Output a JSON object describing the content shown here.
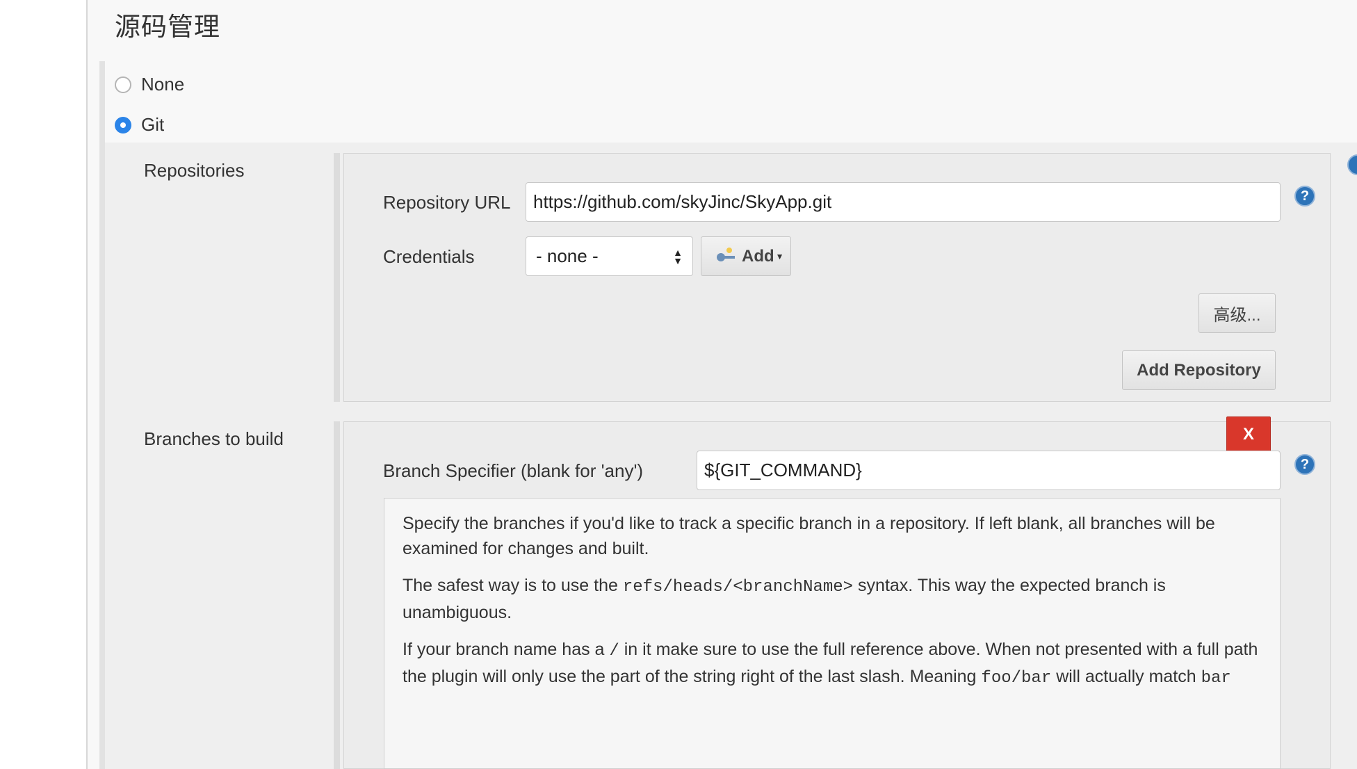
{
  "section": {
    "title": "源码管理"
  },
  "scm": {
    "options": [
      {
        "label": "None",
        "selected": false
      },
      {
        "label": "Git",
        "selected": true
      }
    ]
  },
  "repositories": {
    "label": "Repositories",
    "url_label": "Repository URL",
    "url_value": "https://github.com/skyJinc/SkyApp.git",
    "credentials_label": "Credentials",
    "credentials_value": "- none -",
    "add_label": "Add",
    "advanced_label": "高级...",
    "add_repository_label": "Add Repository"
  },
  "branches": {
    "label": "Branches to build",
    "delete_label": "X",
    "specifier_label": "Branch Specifier (blank for 'any')",
    "specifier_value": "${GIT_COMMAND}",
    "help": {
      "p1": "Specify the branches if you'd like to track a specific branch in a repository. If left blank, all branches will be examined for changes and built.",
      "p2_a": "The safest way is to use the ",
      "p2_code": "refs/heads/<branchName>",
      "p2_b": " syntax. This way the expected branch is unambiguous.",
      "p3_a": "If your branch name has a ",
      "p3_code1": "/",
      "p3_b": " in it make sure to use the full reference above. When not presented with a full path the plugin will only use the part of the string right of the last slash. Meaning ",
      "p3_code2": "foo/bar",
      "p3_c": " will actually match ",
      "p3_code3": "bar"
    }
  },
  "help_icon_glyph": "?",
  "colors": {
    "accent": "#2b84e8",
    "delete": "#d9372b",
    "help": "#2d73b8"
  }
}
